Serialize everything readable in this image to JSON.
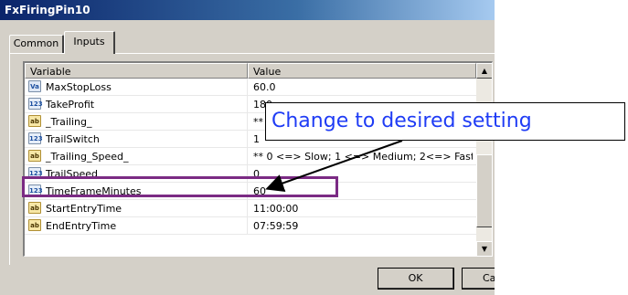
{
  "window": {
    "title": "FxFiringPin10"
  },
  "tabs": [
    {
      "label": "Common",
      "active": false
    },
    {
      "label": "Inputs",
      "active": true
    }
  ],
  "table": {
    "headers": {
      "variable": "Variable",
      "value": "Value"
    },
    "rows": [
      {
        "icon": "Va",
        "icon_name": "double-type-icon",
        "variable": "MaxStopLoss",
        "value": "60.0"
      },
      {
        "icon": "123",
        "icon_name": "integer-type-icon",
        "variable": "TakeProfit",
        "value": "180"
      },
      {
        "icon": "ab",
        "icon_name": "string-type-icon",
        "variable": "_Trailing_",
        "value": "** 0 -"
      },
      {
        "icon": "123",
        "icon_name": "integer-type-icon",
        "variable": "TrailSwitch",
        "value": "1"
      },
      {
        "icon": "ab",
        "icon_name": "string-type-icon",
        "variable": "_Trailing_Speed_",
        "value": "** 0 <=> Slow; 1 <=> Medium; 2<=> Fast **"
      },
      {
        "icon": "123",
        "icon_name": "integer-type-icon",
        "variable": "TrailSpeed",
        "value": "0"
      },
      {
        "icon": "123",
        "icon_name": "integer-type-icon",
        "variable": "TimeFrameMinutes",
        "value": "60"
      },
      {
        "icon": "ab",
        "icon_name": "string-type-icon",
        "variable": "StartEntryTime",
        "value": "11:00:00"
      },
      {
        "icon": "ab",
        "icon_name": "string-type-icon",
        "variable": "EndEntryTime",
        "value": "07:59:59"
      }
    ]
  },
  "buttons": {
    "ok": "OK",
    "cancel": "Ca"
  },
  "annotation": {
    "callout_text": "Change to desired setting",
    "highlight_color": "#7b2b84",
    "callout_text_color": "#1f3cf5"
  }
}
